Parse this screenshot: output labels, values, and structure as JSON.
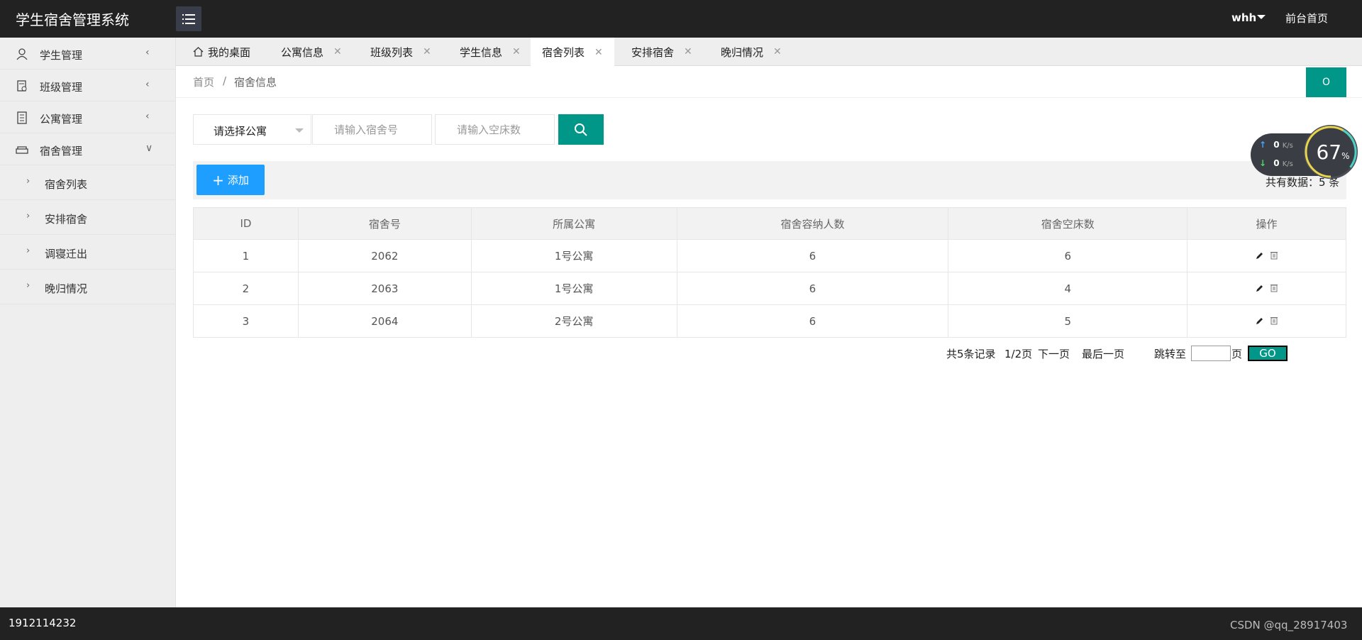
{
  "app": {
    "title": "学生宿舍管理系统",
    "user": "whh",
    "front_link": "前台首页"
  },
  "sidebar": {
    "items": [
      {
        "label": "学生管理",
        "icon": "user-icon",
        "arrow": "<"
      },
      {
        "label": "班级管理",
        "icon": "class-icon",
        "arrow": "<"
      },
      {
        "label": "公寓管理",
        "icon": "document-icon",
        "arrow": "<"
      },
      {
        "label": "宿舍管理",
        "icon": "sofa-icon",
        "arrow": "v"
      }
    ],
    "subitems": [
      {
        "label": "宿舍列表"
      },
      {
        "label": "安排宿舍"
      },
      {
        "label": "调寝迁出"
      },
      {
        "label": "晚归情况"
      }
    ]
  },
  "tabs": [
    {
      "label": "我的桌面",
      "active": false,
      "closable": false
    },
    {
      "label": "公寓信息",
      "active": false,
      "closable": true
    },
    {
      "label": "班级列表",
      "active": false,
      "closable": true
    },
    {
      "label": "学生信息",
      "active": false,
      "closable": true
    },
    {
      "label": "宿舍列表",
      "active": true,
      "closable": true
    },
    {
      "label": "安排宿舍",
      "active": false,
      "closable": true
    },
    {
      "label": "晚归情况",
      "active": false,
      "closable": true
    }
  ],
  "breadcrumb": {
    "home": "首页",
    "separator": "/",
    "current": "宿舍信息"
  },
  "refresh_label": "O",
  "search": {
    "apartment_select": "请选择公寓",
    "dorm_no_placeholder": "请输入宿舍号",
    "empty_beds_placeholder": "请输入空床数"
  },
  "toolbar": {
    "add_label": "添加",
    "total_text": "共有数据：5 条"
  },
  "table": {
    "headers": [
      "ID",
      "宿舍号",
      "所属公寓",
      "宿舍容纳人数",
      "宿舍空床数",
      "操作"
    ],
    "rows": [
      [
        "1",
        "2062",
        "1号公寓",
        "6",
        "6"
      ],
      [
        "2",
        "2063",
        "1号公寓",
        "6",
        "4"
      ],
      [
        "3",
        "2064",
        "2号公寓",
        "6",
        "5"
      ]
    ]
  },
  "pager": {
    "records": "共5条记录",
    "page": "1/2页",
    "next": "下一页",
    "last": "最后一页",
    "jump_to": "跳转至",
    "page_unit": "页",
    "go": "GO"
  },
  "net_widget": {
    "up": "0",
    "down": "0",
    "unit": "K/s",
    "percent": "67",
    "percent_sign": "%"
  },
  "footer": {
    "id_text": "1912114232",
    "watermark": "CSDN @qq_28917403"
  },
  "colors": {
    "header_bg": "#222222",
    "accent": "#009688",
    "add_button": "#1e9fff",
    "sidebar_bg": "#eeeeee"
  }
}
